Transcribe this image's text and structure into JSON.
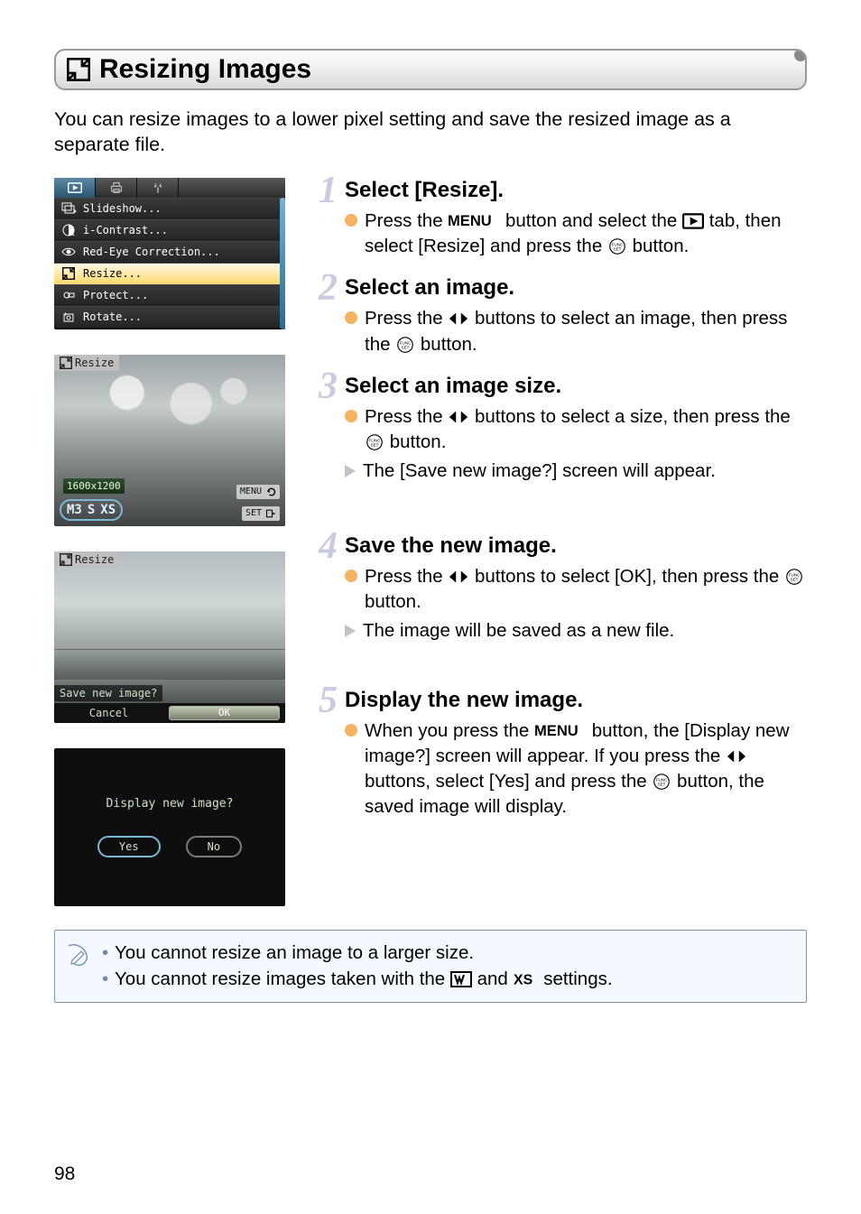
{
  "page_number": "98",
  "title": "Resizing Images",
  "intro": "You can resize images to a lower pixel setting and save the resized image as a separate file.",
  "menu_items": [
    {
      "label": "Slideshow...",
      "icon": "slideshow"
    },
    {
      "label": "i-Contrast...",
      "icon": "icontrast"
    },
    {
      "label": "Red-Eye Correction...",
      "icon": "redeye"
    },
    {
      "label": "Resize...",
      "icon": "resize",
      "hi": true
    },
    {
      "label": "Protect...",
      "icon": "protect"
    },
    {
      "label": "Rotate...",
      "icon": "rotate"
    }
  ],
  "shot_resize": {
    "tag": "Resize",
    "resolution": "1600x1200",
    "options": [
      "M3",
      "S",
      "XS"
    ],
    "menu_btn": "MENU",
    "set_btn": "SET"
  },
  "shot_save": {
    "tag": "Resize",
    "question": "Save new image?",
    "cancel": "Cancel",
    "ok": "OK"
  },
  "shot_display": {
    "question": "Display new image?",
    "yes": "Yes",
    "no": "No"
  },
  "steps": [
    {
      "n": "1",
      "title": "Select [Resize].",
      "bullets": [
        {
          "type": "dot",
          "html": "Press the {MENU} button and select the {PLAY} tab, then select [Resize] and press the {FUNC} button."
        }
      ]
    },
    {
      "n": "2",
      "title": "Select an image.",
      "bullets": [
        {
          "type": "dot",
          "html": "Press the {LR} buttons to select an image, then press the {FUNC} button."
        }
      ]
    },
    {
      "n": "3",
      "title": "Select an image size.",
      "bullets": [
        {
          "type": "dot",
          "html": "Press the {LR} buttons to select a size, then press the {FUNC} button."
        },
        {
          "type": "tri",
          "html": "The [Save new image?] screen will appear."
        }
      ]
    },
    {
      "n": "4",
      "title": "Save the new image.",
      "bullets": [
        {
          "type": "dot",
          "html": "Press the {LR} buttons to select [OK], then press the {FUNC} button."
        },
        {
          "type": "tri",
          "html": "The image will be saved as a new file."
        }
      ]
    },
    {
      "n": "5",
      "title": "Display the new image.",
      "bullets": [
        {
          "type": "dot",
          "html": "When you press the {MENU} button, the [Display new image?] screen will appear. If you press the {LR} buttons, select [Yes] and press the {FUNC} button, the saved image will display."
        }
      ]
    }
  ],
  "tips": [
    "You cannot resize an image to a larger size.",
    "You cannot resize images taken with the {W} and {XS} settings."
  ]
}
